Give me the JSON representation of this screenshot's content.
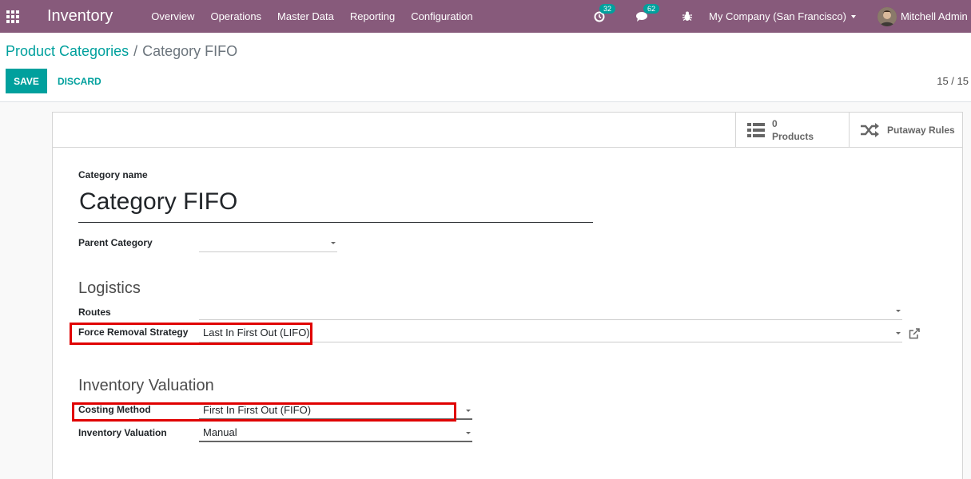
{
  "navbar": {
    "app_title": "Inventory",
    "menu": [
      "Overview",
      "Operations",
      "Master Data",
      "Reporting",
      "Configuration"
    ],
    "activity_count": "32",
    "messages_count": "62",
    "company": "My Company (San Francisco)",
    "user": "Mitchell Admin (",
    "bg_color": "#875a7b"
  },
  "breadcrumb": {
    "parent": "Product Categories",
    "separator": "/",
    "current": "Category FIFO"
  },
  "actions": {
    "save": "SAVE",
    "discard": "DISCARD"
  },
  "pager": "15 / 15",
  "stat_buttons": {
    "products_count": "0",
    "products_label": "Products",
    "putaway_label": "Putaway Rules"
  },
  "form": {
    "category_name_label": "Category name",
    "category_name": "Category FIFO",
    "parent_category_label": "Parent Category",
    "parent_category_value": "",
    "logistics_title": "Logistics",
    "routes_label": "Routes",
    "routes_value": "",
    "removal_label": "Force Removal Strategy",
    "removal_value": "Last In First Out (LIFO)",
    "valuation_title": "Inventory Valuation",
    "costing_label": "Costing Method",
    "costing_value": "First In First Out (FIFO)",
    "valuation_label": "Inventory Valuation",
    "valuation_value": "Manual"
  },
  "colors": {
    "accent": "#00a09d",
    "highlight": "#e00000"
  }
}
